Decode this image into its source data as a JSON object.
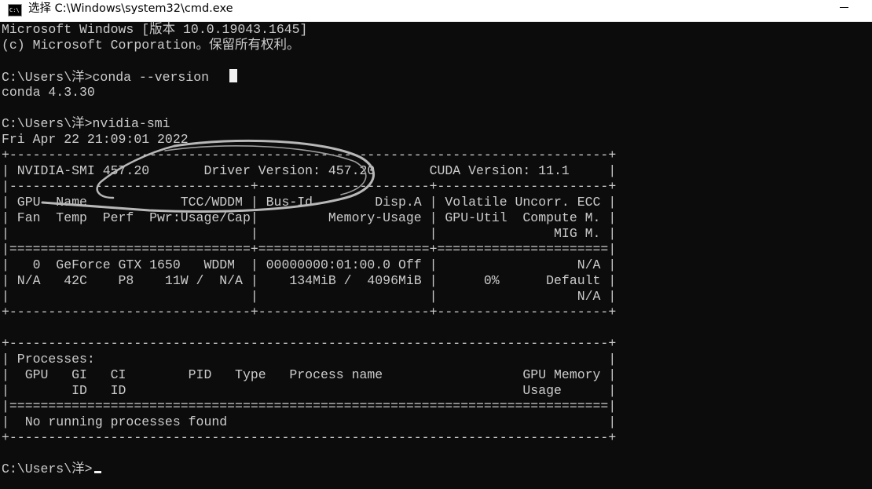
{
  "window": {
    "title": "选择 C:\\Windows\\system32\\cmd.exe",
    "icon_text": "C:\\",
    "icon": "console-app-icon",
    "minimize_icon": "minimize-icon"
  },
  "console": {
    "lines": [
      "Microsoft Windows [版本 10.0.19043.1645]",
      "(c) Microsoft Corporation。保留所有权利。",
      "",
      "C:\\Users\\洋>conda --version",
      "conda 4.3.30",
      "",
      "C:\\Users\\洋>nvidia-smi",
      "Fri Apr 22 21:09:01 2022",
      "+-----------------------------------------------------------------------------+",
      "| NVIDIA-SMI 457.20       Driver Version: 457.20       CUDA Version: 11.1     |",
      "|-------------------------------+----------------------+----------------------+",
      "| GPU  Name            TCC/WDDM | Bus-Id        Disp.A | Volatile Uncorr. ECC |",
      "| Fan  Temp  Perf  Pwr:Usage/Cap|         Memory-Usage | GPU-Util  Compute M. |",
      "|                               |                      |               MIG M. |",
      "|===============================+======================+======================|",
      "|   0  GeForce GTX 1650   WDDM  | 00000000:01:00.0 Off |                  N/A |",
      "| N/A   42C    P8    11W /  N/A |    134MiB /  4096MiB |      0%      Default |",
      "|                               |                      |                  N/A |",
      "+-------------------------------+----------------------+----------------------+",
      "",
      "+-----------------------------------------------------------------------------+",
      "| Processes:                                                                  |",
      "|  GPU   GI   CI        PID   Type   Process name                  GPU Memory |",
      "|        ID   ID                                                   Usage      |",
      "|=============================================================================|",
      "|  No running processes found                                                 |",
      "+-----------------------------------------------------------------------------+",
      "",
      "C:\\Users\\洋>"
    ],
    "cursor_line_index": 3,
    "prompt_line_index": 28
  },
  "colors": {
    "console_background": "#0c0c0c",
    "console_text": "#cccccc",
    "cursor": "#f2f2f2",
    "titlebar_background": "#ffffff",
    "annotation_stroke": "#b8b8b8"
  }
}
